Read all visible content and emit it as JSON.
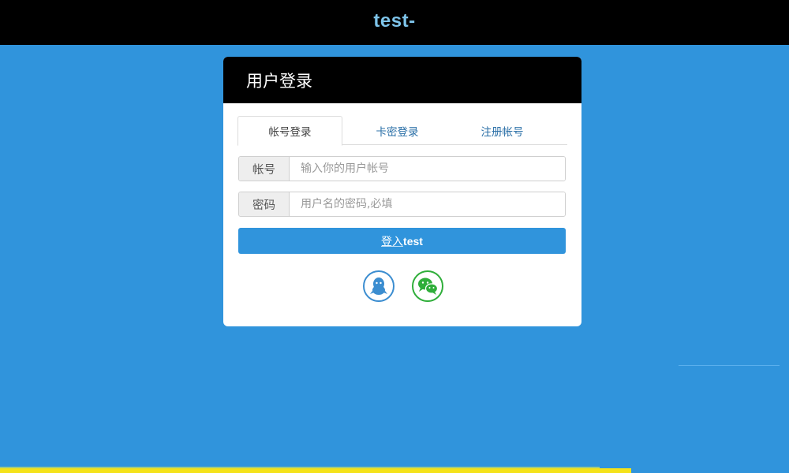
{
  "header": {
    "brand": "test-"
  },
  "panel": {
    "title": "用户登录",
    "tabs": [
      {
        "label": "帐号登录",
        "active": true
      },
      {
        "label": "卡密登录",
        "active": false
      },
      {
        "label": "注册帐号",
        "active": false
      }
    ],
    "account": {
      "label": "帐号",
      "placeholder": "输入你的用户帐号",
      "value": ""
    },
    "password": {
      "label": "密码",
      "placeholder": "用户名的密码,必填",
      "value": ""
    },
    "login_button": {
      "prefix": "登入",
      "suffix": "test"
    },
    "social": [
      {
        "name": "qq",
        "icon": "qq-penguin-icon"
      },
      {
        "name": "wechat",
        "icon": "wechat-icon"
      }
    ]
  },
  "colors": {
    "background": "#3094dc",
    "header": "#000000",
    "brand_text": "#7ec4ea",
    "button": "#3094dc",
    "qq": "#3b8dd0",
    "wechat": "#2fae3a"
  }
}
